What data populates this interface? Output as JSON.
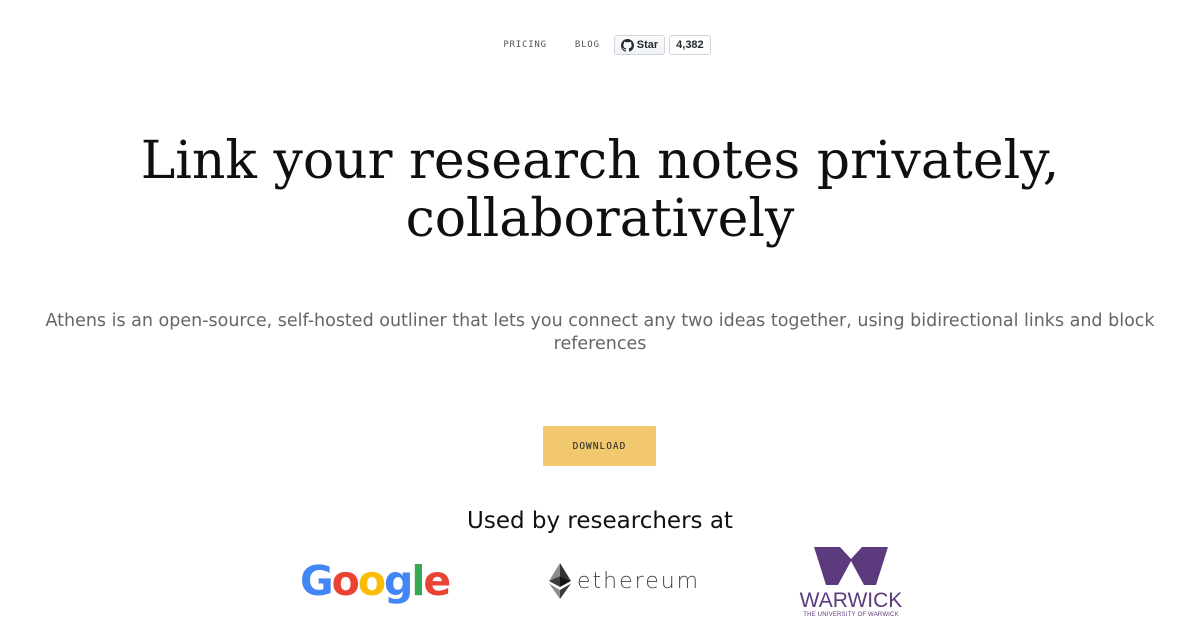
{
  "nav": {
    "pricing_label": "PRICING",
    "blog_label": "BLOG",
    "github_star_label": "Star",
    "github_star_count": "4,382"
  },
  "hero": {
    "title_line1": "Link your research notes privately,",
    "title_line2": "collaboratively",
    "subtitle": "Athens is an open-source, self-hosted outliner that lets you connect any two ideas together, using bidirectional links and block references"
  },
  "cta": {
    "download_label": "DOWNLOAD",
    "color": "#f1c86e"
  },
  "used_by": {
    "heading": "Used by researchers at",
    "logos": {
      "google": {
        "letters": [
          "G",
          "o",
          "o",
          "g",
          "l",
          "e"
        ],
        "colors": [
          "#4285f4",
          "#ea4335",
          "#fbbc05",
          "#4285f4",
          "#34a853",
          "#ea4335"
        ]
      },
      "ethereum": {
        "wordmark": "ethereum",
        "icon": "ethereum-diamond-icon"
      },
      "warwick": {
        "name": "WARWICK",
        "tagline": "THE UNIVERSITY OF WARWICK",
        "color": "#5b3a7e",
        "icon": "warwick-w-icon"
      }
    }
  }
}
